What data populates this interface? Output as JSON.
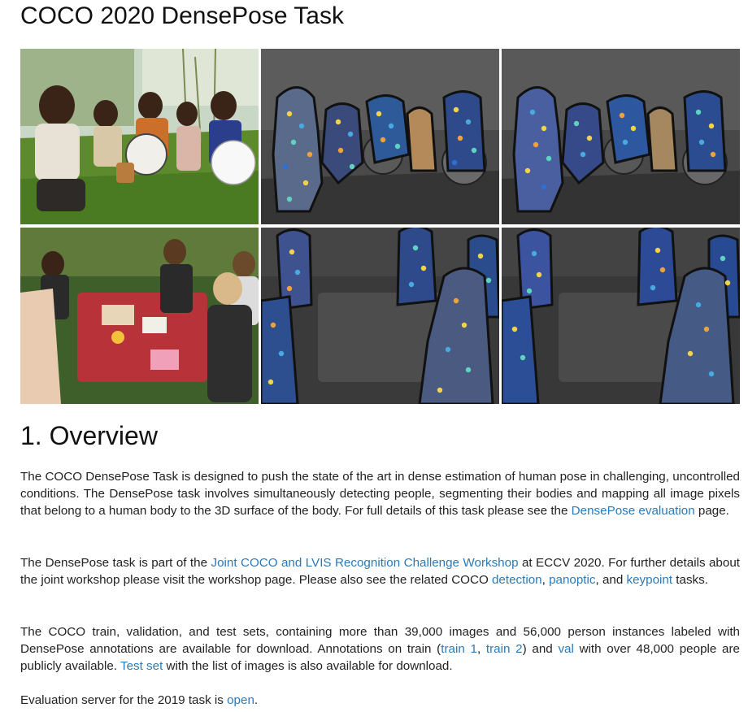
{
  "page": {
    "title": "COCO 2020 DensePose Task",
    "section_title": "1. Overview"
  },
  "figure": {
    "panels": [
      {
        "name": "photo-children-outdoors",
        "kind": "photo"
      },
      {
        "name": "densepose-children-ground-truth",
        "kind": "overlay"
      },
      {
        "name": "densepose-children-prediction",
        "kind": "overlay"
      },
      {
        "name": "photo-picnic-group",
        "kind": "photo"
      },
      {
        "name": "densepose-picnic-ground-truth",
        "kind": "overlay"
      },
      {
        "name": "densepose-picnic-prediction",
        "kind": "overlay"
      }
    ]
  },
  "paragraphs": {
    "p1": {
      "t1": "The COCO DensePose Task is designed to push the state of the art in dense estimation of human pose in challenging, uncontrolled conditions. The DensePose task involves simultaneously detecting people, segmenting their bodies and mapping all image pixels that belong to a human body to the 3D surface of the body. For full details of this task please see the ",
      "link_eval": "DensePose evaluation",
      "t2": " page."
    },
    "p2": {
      "t1": "The DensePose task is part of the ",
      "link_workshop": "Joint COCO and LVIS Recognition Challenge Workshop",
      "t2": " at ECCV 2020. For further details about the joint workshop please visit the workshop page. Please also see the related COCO ",
      "link_detection": "detection",
      "t3": ", ",
      "link_panoptic": "panoptic",
      "t4": ", and ",
      "link_keypoint": "keypoint",
      "t5": " tasks."
    },
    "p3": {
      "t1": "The COCO train, validation, and test sets, containing more than 39,000 images and 56,000 person instances labeled with DensePose annotations are available for download. Annotations on train (",
      "link_train1": "train 1",
      "t2": ", ",
      "link_train2": "train 2",
      "t3": ") and ",
      "link_val": "val",
      "t4": " with over 48,000 people are publicly available. ",
      "link_testset": "Test set",
      "t5": " with the list of images is also available for download."
    },
    "p4": {
      "t1": "Evaluation server for the 2019 task is ",
      "link_open": "open",
      "t2": "."
    }
  },
  "colors": {
    "link": "#2a7ab9",
    "text": "#222222",
    "heading": "#111111"
  }
}
